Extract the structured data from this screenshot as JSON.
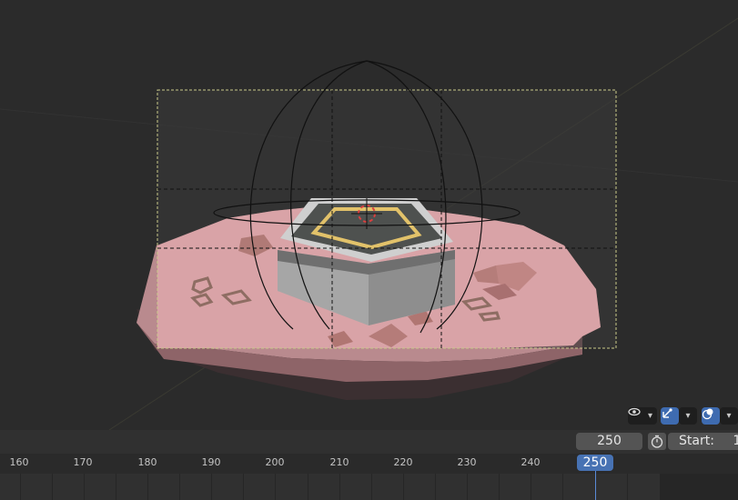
{
  "viewport": {
    "header_buttons": [
      {
        "name": "visibility",
        "icon": "eye-icon"
      },
      {
        "name": "gizmo",
        "icon": "gizmo-icon"
      },
      {
        "name": "overlays",
        "icon": "overlays-icon"
      }
    ],
    "colors": {
      "background": "#2b2b2b",
      "ground": "#d8a2a6",
      "frame_border": "#c9c98a",
      "accent_gold": "#e2c26a"
    }
  },
  "timeline": {
    "current_frame_field": "250",
    "start_label": "Start:",
    "start_value": "1",
    "current_frame_badge": "250",
    "ruler_ticks": [
      "160",
      "170",
      "180",
      "190",
      "200",
      "210",
      "220",
      "230",
      "240"
    ]
  },
  "colors": {
    "accent": "#4772b3",
    "field_bg": "#545454",
    "button_active": "#3e6bb0"
  }
}
